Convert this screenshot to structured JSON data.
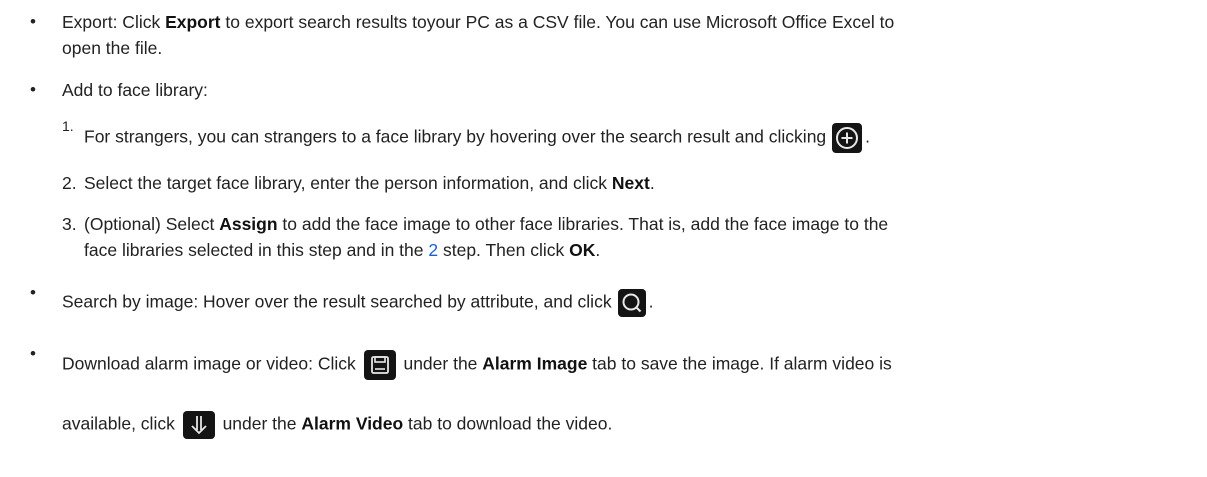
{
  "items": {
    "export": {
      "pre": "Export: Click ",
      "bold": "Export",
      "post": " to export search results toyour PC as a CSV file. You can use Microsoft Office Excel to",
      "line2": "open the file."
    },
    "add_to_library": {
      "label": "Add to face library:",
      "steps": [
        {
          "num": "1.",
          "text": "For strangers, you can strangers to a face library by hovering over the search result and clicking",
          "suffix": "."
        },
        {
          "num": "2.",
          "pre": "Select the target face library, enter the person information, and click ",
          "bold": "Next",
          "post": "."
        },
        {
          "num": "3.",
          "pre": "(Optional) Select ",
          "bold": "Assign",
          "post": " to add the face image to other face libraries. That is, add the face image to the",
          "line2_pre": "face libraries selected in this step and in the ",
          "line2_link": "2",
          "line2_mid": " step. Then click ",
          "line2_bold": "OK",
          "line2_post": "."
        }
      ]
    },
    "search_by_image": {
      "text": "Search by image: Hover over the result searched by attribute, and click",
      "suffix": "."
    },
    "download": {
      "pre": "Download alarm image or video: Click ",
      "mid1": " under the ",
      "bold1": "Alarm Image",
      "post1": " tab to save the image. If alarm video is",
      "line2_pre": "available, click ",
      "line2_mid": " under the ",
      "line2_bold": "Alarm Video",
      "line2_post": " tab to download the video."
    }
  },
  "icons": {
    "add": "plus-circle-icon",
    "search": "magnifier-icon",
    "save": "floppy-disk-icon",
    "download": "download-arrow-icon"
  }
}
